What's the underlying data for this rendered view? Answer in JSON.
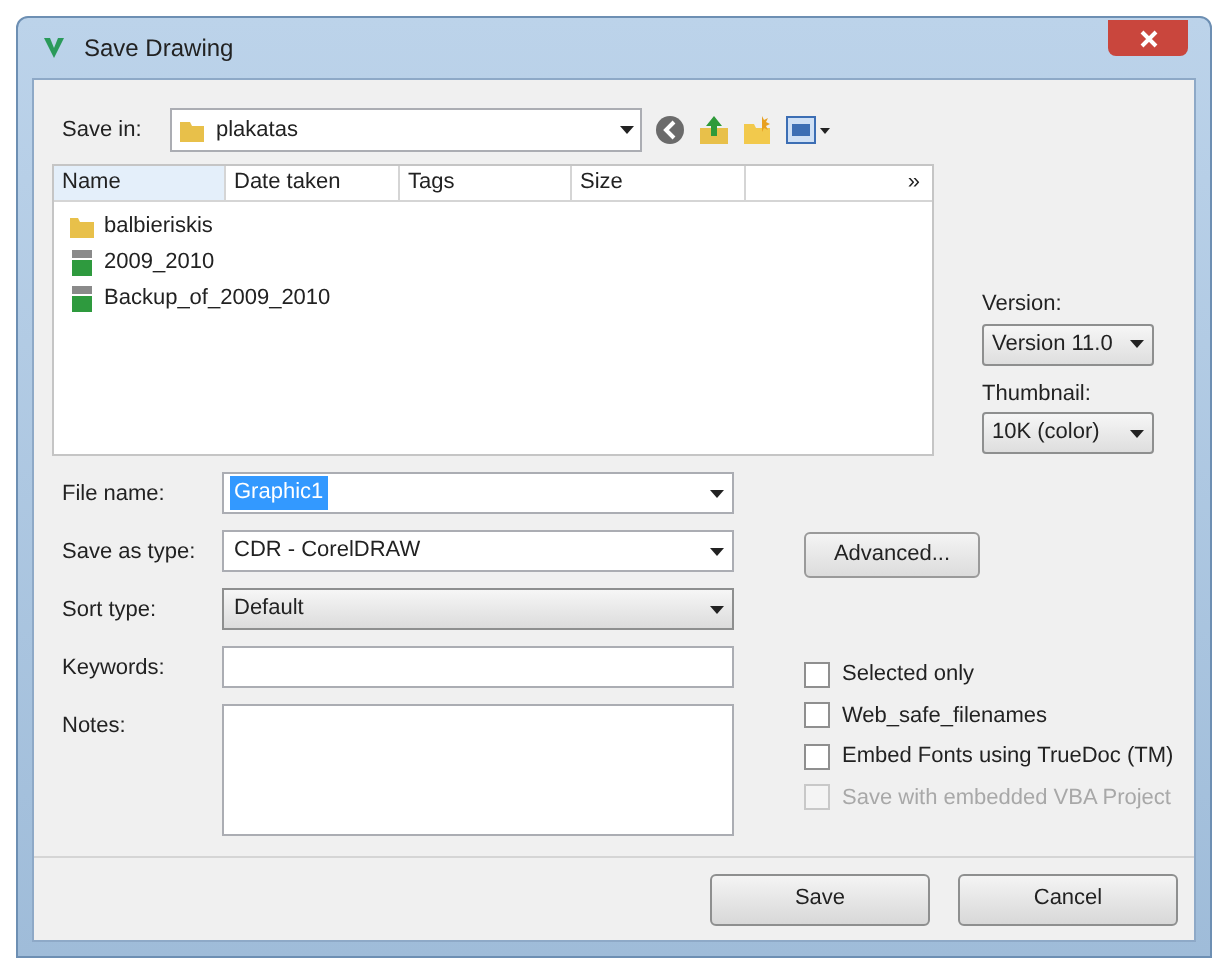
{
  "window": {
    "title": "Save Drawing"
  },
  "save_in": {
    "label": "Save in:",
    "value": "plakatas"
  },
  "file_list": {
    "columns": [
      "Name",
      "Date taken",
      "Tags",
      "Size"
    ],
    "more": "»",
    "items": [
      {
        "name": "balbieriskis",
        "kind": "folder"
      },
      {
        "name": "2009_2010",
        "kind": "drawing"
      },
      {
        "name": "Backup_of_2009_2010",
        "kind": "drawing"
      }
    ]
  },
  "version": {
    "label": "Version:",
    "value": "Version 11.0"
  },
  "thumbnail": {
    "label": "Thumbnail:",
    "value": "10K (color)"
  },
  "fields": [
    {
      "label": "File name:",
      "value": "Graphic1",
      "kind": "combo",
      "selected": true
    },
    {
      "label": "Save as type:",
      "value": "CDR - CorelDRAW",
      "kind": "combo",
      "selected": false
    },
    {
      "label": "Sort type:",
      "value": "Default",
      "kind": "dropdown",
      "selected": false
    },
    {
      "label": "Keywords:",
      "kind": "text"
    },
    {
      "label": "Notes:",
      "kind": "area"
    }
  ],
  "advanced_button": "Advanced...",
  "options": [
    {
      "label": "Selected only",
      "checked": false,
      "disabled": false
    },
    {
      "label": "Web_safe_filenames",
      "checked": false,
      "disabled": false
    },
    {
      "label": "Embed Fonts using TrueDoc (TM)",
      "checked": false,
      "disabled": false
    },
    {
      "label": "Save with embedded VBA Project",
      "checked": false,
      "disabled": true
    }
  ],
  "buttons": [
    "Save",
    "Cancel"
  ]
}
